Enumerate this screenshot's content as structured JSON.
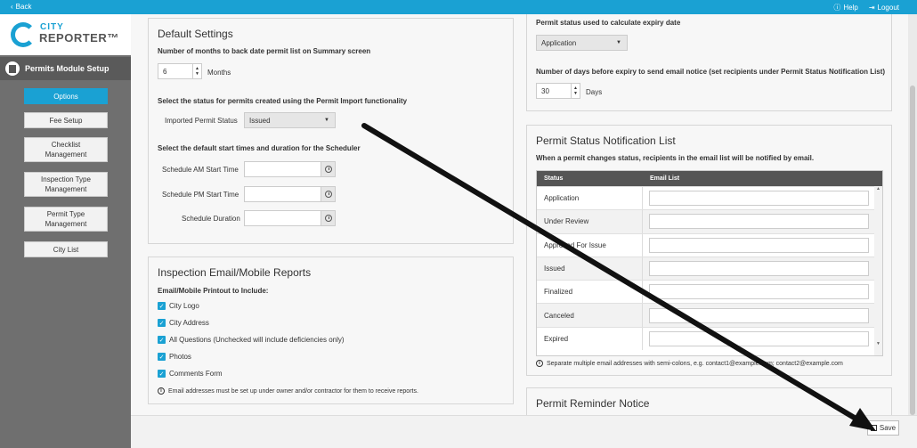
{
  "topbar": {
    "back_label": "Back",
    "help_label": "Help",
    "logout_label": "Logout"
  },
  "logo": {
    "line1": "CITY",
    "line2": "REPORTER™"
  },
  "sidebar": {
    "title": "Permits Module Setup",
    "items": [
      {
        "label": "Options"
      },
      {
        "label": "Fee Setup"
      },
      {
        "label": "Checklist Management"
      },
      {
        "label": "Inspection Type Management"
      },
      {
        "label": "Permit Type Management"
      },
      {
        "label": "City List"
      }
    ]
  },
  "default_settings": {
    "title": "Default Settings",
    "months_label": "Number of months to back date permit list on Summary screen",
    "months_value": "6",
    "months_unit": "Months",
    "import_label": "Select the status for permits created using the Permit Import functionality",
    "imported_status_label": "Imported Permit Status",
    "imported_status_value": "Issued",
    "scheduler_label": "Select the default start times and duration for the Scheduler",
    "am_label": "Schedule AM Start Time",
    "pm_label": "Schedule PM Start Time",
    "duration_label": "Schedule Duration"
  },
  "inspection_email": {
    "title": "Inspection Email/Mobile Reports",
    "include_label": "Email/Mobile Printout to Include:",
    "options": [
      {
        "label": "City Logo"
      },
      {
        "label": "City Address"
      },
      {
        "label": "All Questions (Unchecked will include deficiencies only)"
      },
      {
        "label": "Photos"
      },
      {
        "label": "Comments Form"
      }
    ],
    "note": "Email addresses must be set up under owner and/or contractor for them to receive reports."
  },
  "expiry": {
    "status_label": "Permit status used to calculate expiry date",
    "status_value": "Application",
    "days_label": "Number of days before expiry to send email notice (set recipients under Permit Status Notification List)",
    "days_value": "30",
    "days_unit": "Days"
  },
  "notification_list": {
    "title": "Permit Status Notification List",
    "description": "When a permit changes status, recipients in the email list will be notified by email.",
    "columns": [
      "Status",
      "Email List"
    ],
    "rows": [
      {
        "status": "Application"
      },
      {
        "status": "Under Review"
      },
      {
        "status": "Approved For Issue"
      },
      {
        "status": "Issued"
      },
      {
        "status": "Finalized"
      },
      {
        "status": "Canceled"
      },
      {
        "status": "Expired"
      }
    ],
    "note": "Separate multiple email addresses with semi-colons, e.g. contact1@example.com; contact2@example.com"
  },
  "reminder": {
    "title": "Permit Reminder Notice"
  },
  "footer": {
    "save_label": "Save"
  },
  "colors": {
    "accent": "#1aa1d3",
    "sidebar": "#6f6f6f",
    "table_header": "#555555"
  }
}
